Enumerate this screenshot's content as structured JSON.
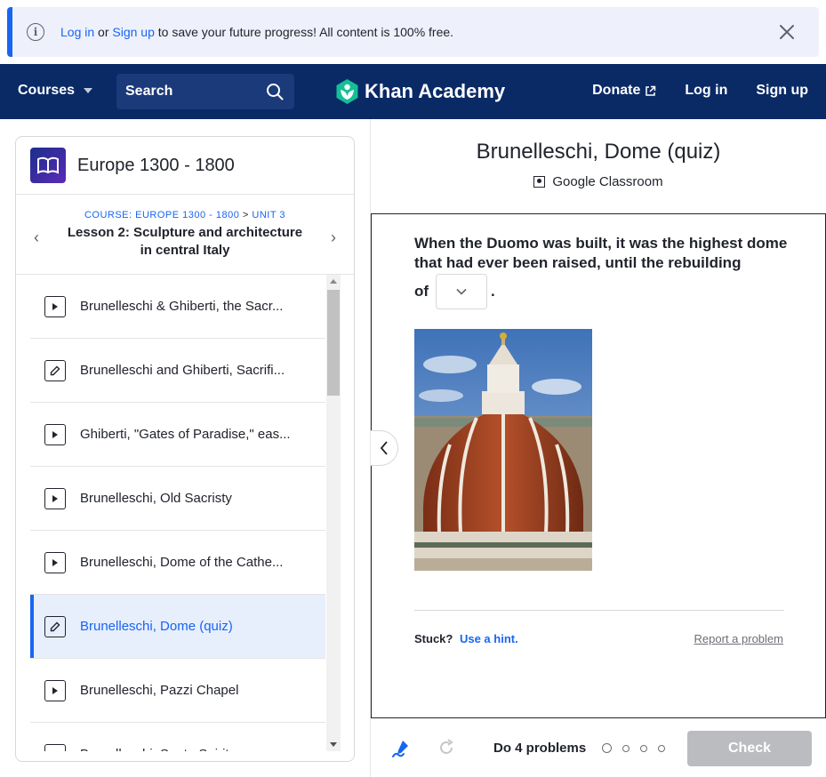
{
  "banner": {
    "login_link": "Log in",
    "or_text": "or",
    "signup_link": "Sign up",
    "message_rest": "to save your future progress! All content is 100% free."
  },
  "nav": {
    "courses": "Courses",
    "search_placeholder": "Search",
    "logo_text": "Khan Academy",
    "donate": "Donate",
    "login": "Log in",
    "signup": "Sign up"
  },
  "sidebar": {
    "course_title": "Europe 1300 - 1800",
    "breadcrumb_course": "COURSE: EUROPE 1300 - 1800",
    "breadcrumb_sep": ">",
    "breadcrumb_unit": "UNIT 3",
    "lesson_title": "Lesson 2: Sculpture and architecture in central Italy",
    "items": [
      {
        "type": "video",
        "label": "Brunelleschi & Ghiberti, the Sacr..."
      },
      {
        "type": "exercise",
        "label": "Brunelleschi and Ghiberti, Sacrifi..."
      },
      {
        "type": "video",
        "label": "Ghiberti, \"Gates of Paradise,\" eas..."
      },
      {
        "type": "video",
        "label": "Brunelleschi, Old Sacristy"
      },
      {
        "type": "video",
        "label": "Brunelleschi, Dome of the Cathe..."
      },
      {
        "type": "exercise",
        "label": "Brunelleschi, Dome (quiz)",
        "active": true
      },
      {
        "type": "video",
        "label": "Brunelleschi, Pazzi Chapel"
      },
      {
        "type": "video",
        "label": "Brunelleschi, Santo Spirito"
      }
    ]
  },
  "quiz": {
    "title": "Brunelleschi, Dome (quiz)",
    "classroom": "Google Classroom",
    "question_lines": "When the Duomo was built, it was the highest dome that had ever been raised, until the rebuilding",
    "question_of": "of",
    "question_end": ".",
    "stuck": "Stuck?",
    "hint": "Use a hint.",
    "report": "Report a problem"
  },
  "footer": {
    "progress_text": "Do 4 problems",
    "check": "Check"
  },
  "colors": {
    "nav_bg": "#0a2a66",
    "accent": "#1865f2",
    "logo_green": "#14bf96"
  }
}
